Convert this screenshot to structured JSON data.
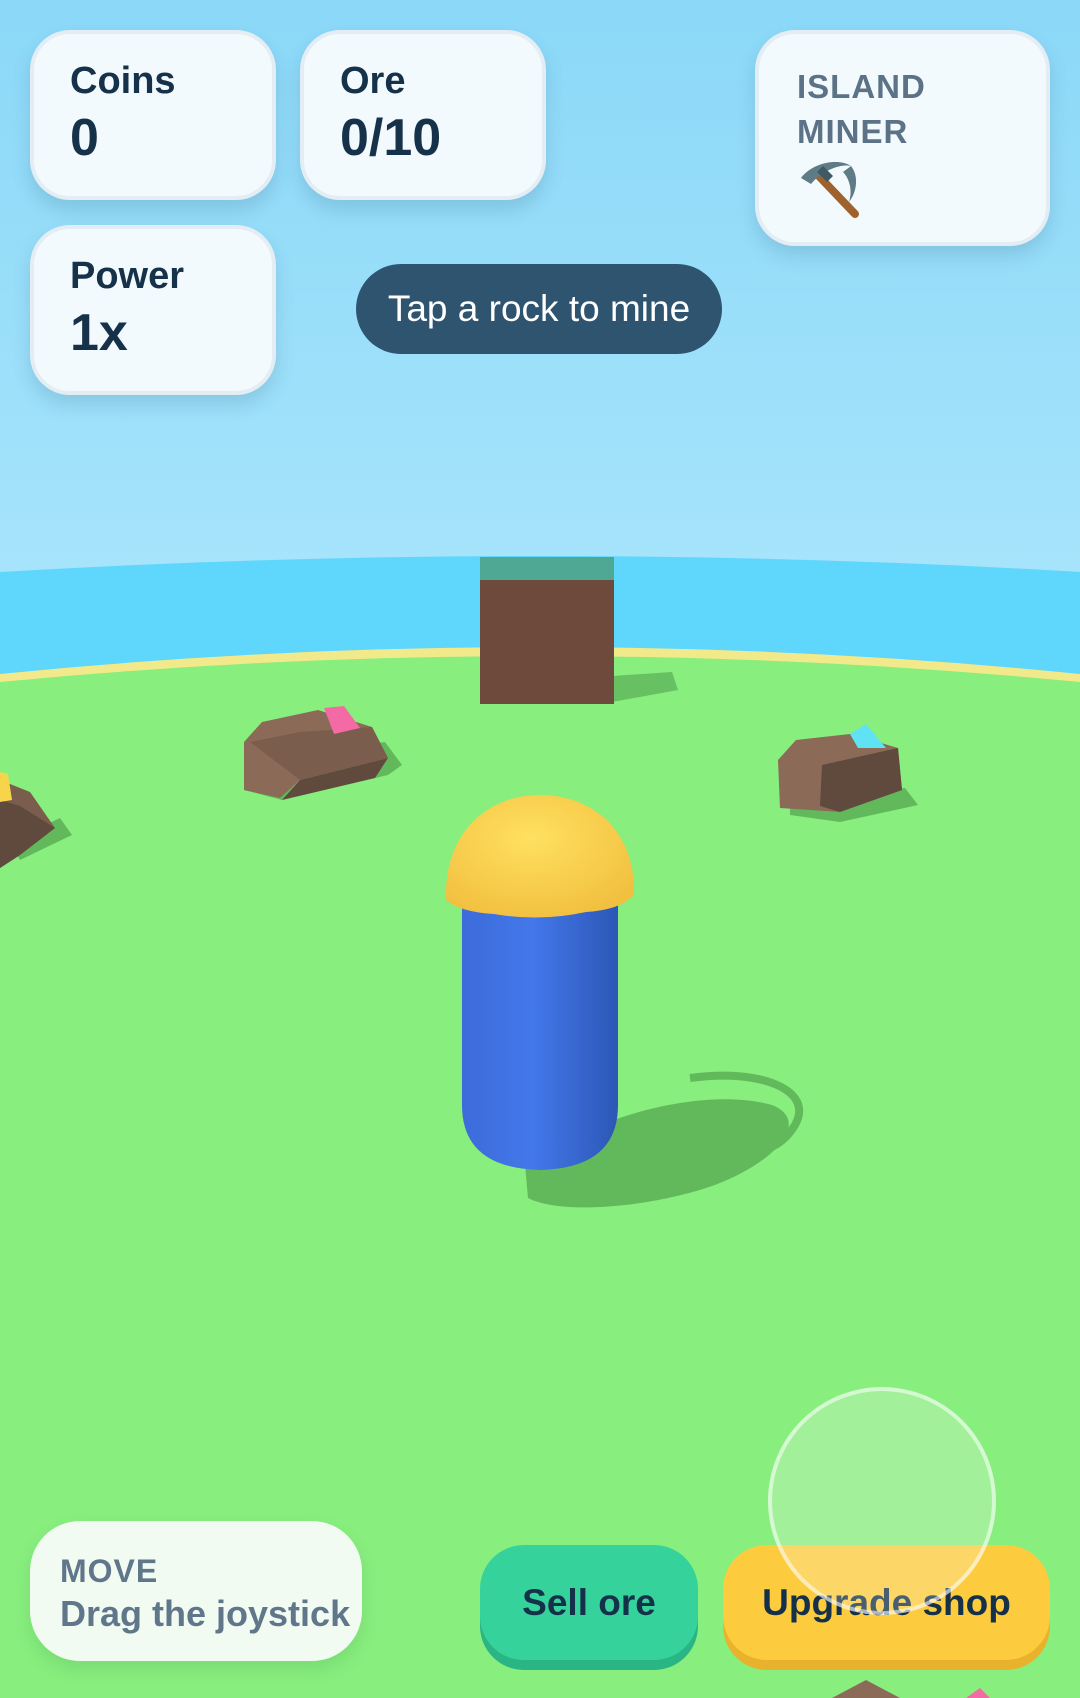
{
  "hud": {
    "coins": {
      "label": "Coins",
      "value": "0"
    },
    "ore": {
      "label": "Ore",
      "value": "0/10"
    },
    "power": {
      "label": "Power",
      "value": "1x"
    }
  },
  "title": {
    "line1": "ISLAND",
    "line2": "MINER",
    "icon": "pickaxe-icon"
  },
  "hint": "Tap a rock to mine",
  "move": {
    "key": "MOVE",
    "description": "Drag the joystick"
  },
  "actions": {
    "sell": "Sell ore",
    "upgrade": "Upgrade shop"
  },
  "colors": {
    "sky": "#8bd9f8",
    "sea": "#5fd6fb",
    "grass": "#88ee7e",
    "sand": "#f2ea8a",
    "rock": "#8b6b58",
    "player_body": "#3f72e6",
    "player_head": "#fbd251",
    "gem_pink": "#f36aa4",
    "gem_cyan": "#5fe3f4",
    "gem_yellow": "#f6d54a"
  }
}
